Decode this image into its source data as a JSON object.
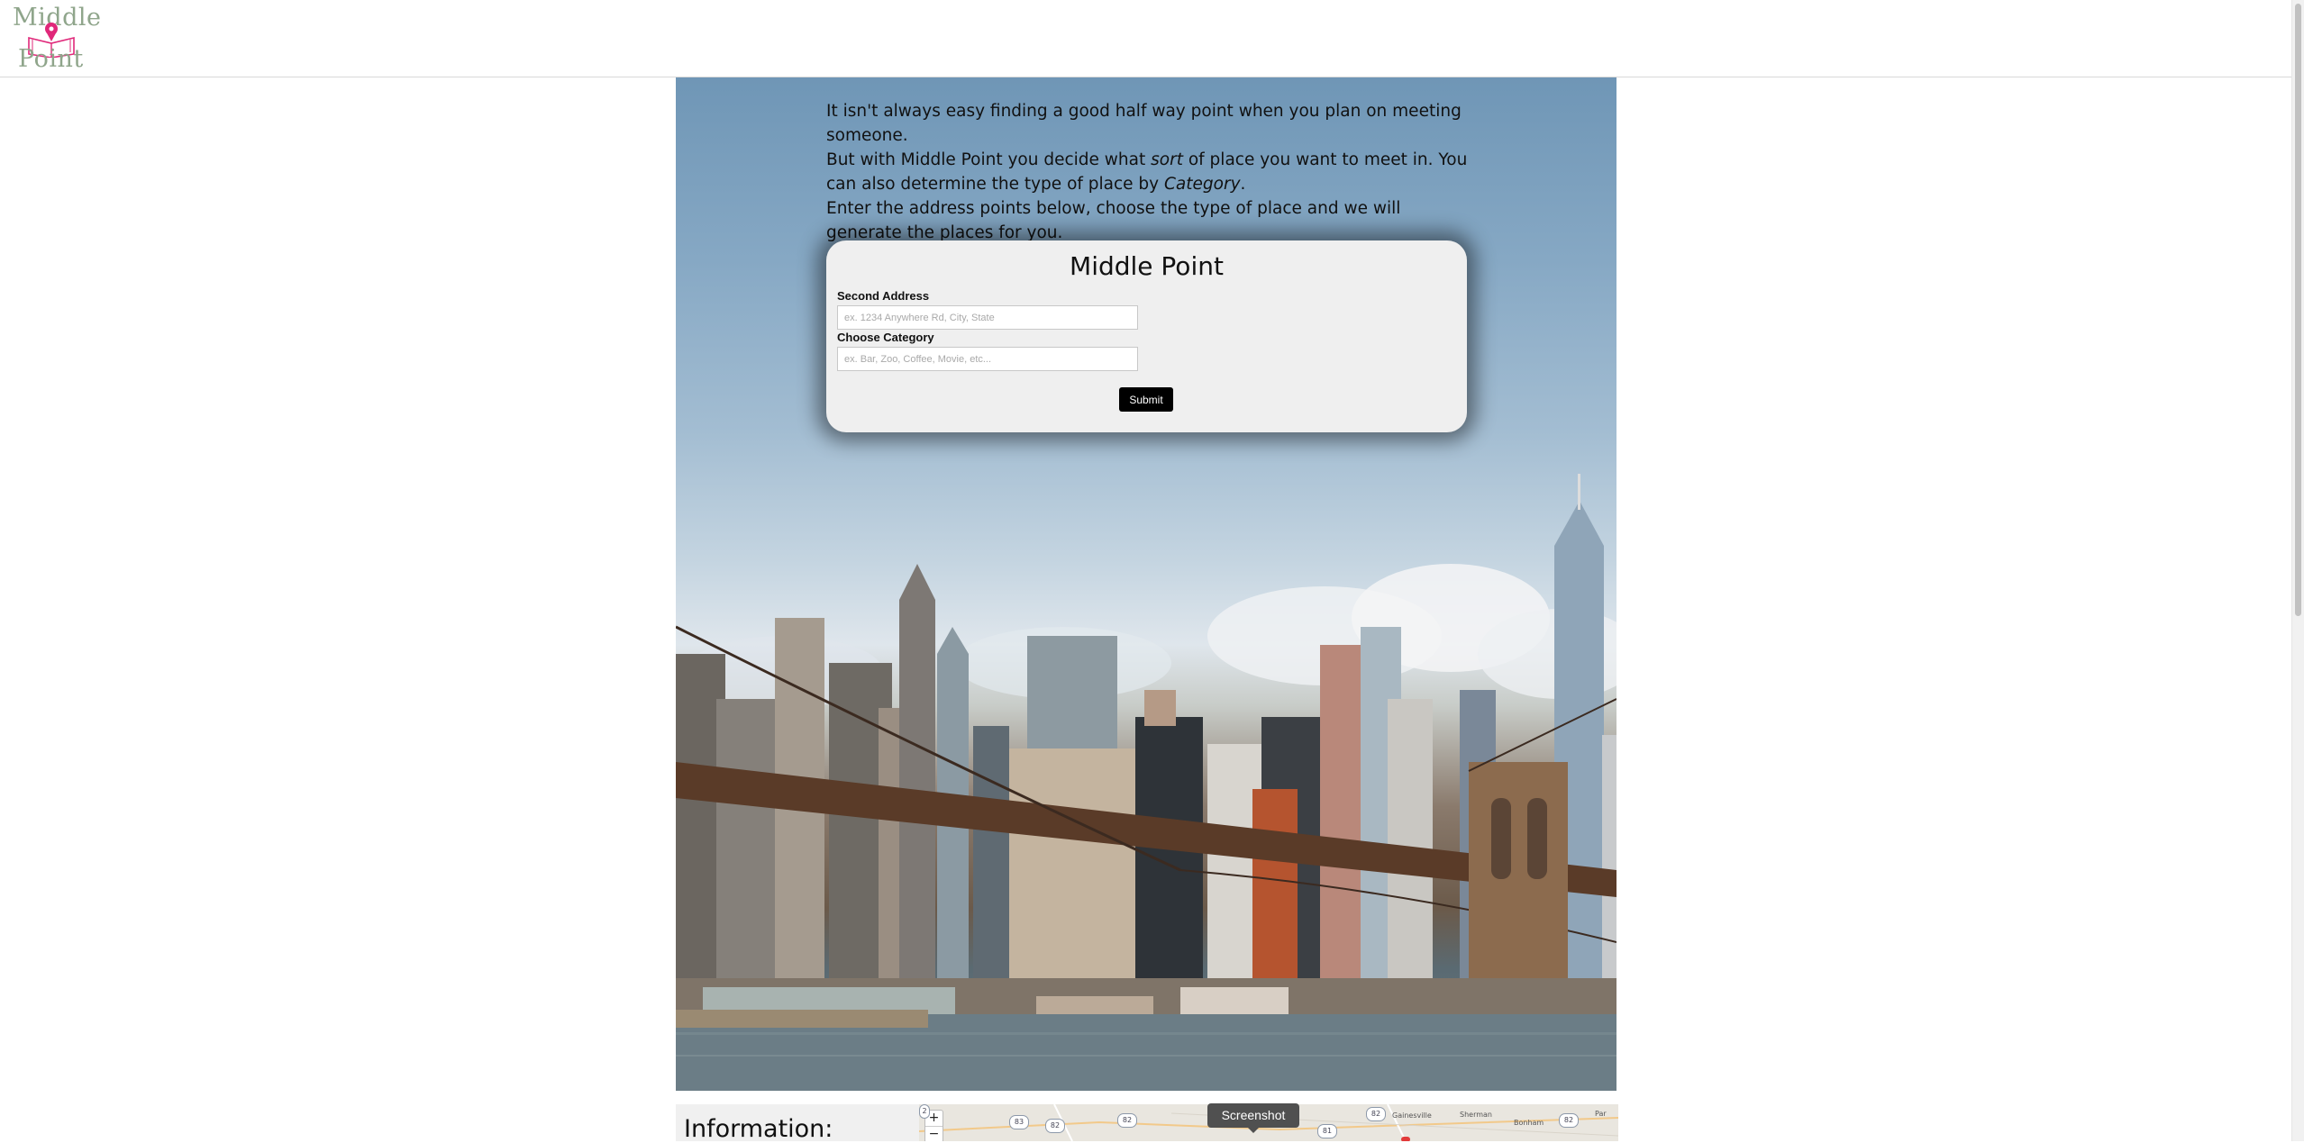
{
  "header": {
    "logo_line_1": "Middle",
    "logo_line_2": "Point",
    "logo_icon": "map-pin-book-icon"
  },
  "intro": {
    "line1_part1": "It isn't always easy finding a good half way point when you plan on meeting someone.",
    "line2_part1": "But with Middle Point you decide what ",
    "line2_em": "sort",
    "line2_part2": " of place you want to meet in. You can also determine the type of place by ",
    "line2_em2": "Category",
    "line2_part3": ".",
    "line3": "Enter the address points below, choose the type of place and we will generate the places for you."
  },
  "form": {
    "title": "Middle Point",
    "address_label": "Second Address",
    "address_placeholder": "ex. 1234 Anywhere Rd, City, State",
    "category_label": "Choose Category",
    "category_placeholder": "ex. Bar, Zoo, Coffee, Movie, etc...",
    "submit_label": "Submit"
  },
  "info": {
    "title": "Information:"
  },
  "map": {
    "zoom_in": "+",
    "zoom_out": "−",
    "badges": [
      "83",
      "82",
      "82",
      "81",
      "82",
      "82",
      "2"
    ],
    "towns": [
      "Gainesville",
      "Sherman",
      "Bonham",
      "Par"
    ]
  },
  "tooltip": {
    "label": "Screenshot"
  },
  "colors": {
    "logo_text": "#8fa58b",
    "logo_pin": "#e0287a",
    "button_bg": "#000000",
    "card_bg": "#efefef"
  }
}
